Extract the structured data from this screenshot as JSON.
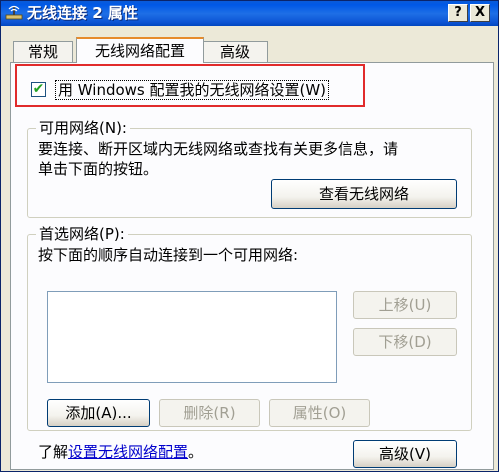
{
  "window": {
    "title": "无线连接 2 属性",
    "help_glyph": "?",
    "close_glyph": "X"
  },
  "tabs": [
    {
      "label": "常规"
    },
    {
      "label": "无线网络配置"
    },
    {
      "label": "高级"
    }
  ],
  "use_windows": {
    "checked": true,
    "check_glyph": "✔",
    "label": "用 Windows 配置我的无线网络设置(W)"
  },
  "available": {
    "title": "可用网络(N):",
    "description_line1": "要连接、断开区域内无线网络或查找有关更多信息，请",
    "description_line2": "单击下面的按钮。",
    "view_button": "查看无线网络"
  },
  "preferred": {
    "title": "首选网络(P):",
    "description": "按下面的顺序自动连接到一个可用网络:",
    "items": [],
    "move_up_button": "上移(U)",
    "move_down_button": "下移(D)",
    "add_button": "添加(A)...",
    "remove_button": "删除(R)",
    "properties_button": "属性(O)"
  },
  "footer": {
    "learn_prefix": "了解",
    "learn_link": "设置无线网络配置",
    "learn_suffix": "。",
    "advanced_button": "高级(V)"
  },
  "colors": {
    "titlebar": "#0058e6",
    "highlight": "#e12b2b",
    "link": "#0000cc"
  }
}
